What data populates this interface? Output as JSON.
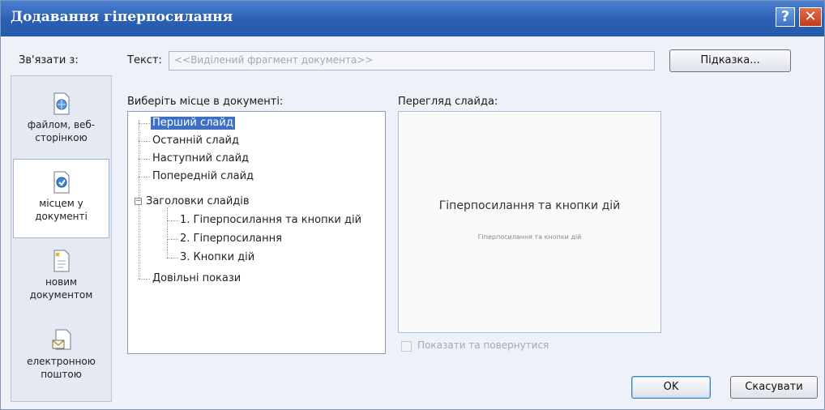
{
  "window": {
    "title": "Додавання гіперпосилання"
  },
  "title_buttons": {
    "help": "?",
    "close": "✕"
  },
  "link_to_label": "Зв'язати з:",
  "text_field": {
    "label": "Текст:",
    "value": "<<Виділений фрагмент документа>>"
  },
  "hint_button": "Підказка...",
  "side_items": [
    {
      "label1": "файлом, веб-",
      "label2": "сторінкою",
      "icon": "globe-file-icon"
    },
    {
      "label1": "місцем у",
      "label2": "документі",
      "icon": "document-place-icon"
    },
    {
      "label1": "новим",
      "label2": "документом",
      "icon": "new-document-icon"
    },
    {
      "label1": "електронною",
      "label2": "поштою",
      "icon": "email-icon"
    }
  ],
  "tree": {
    "label": "Виберіть місце в документі:",
    "items": [
      {
        "text": "Перший слайд"
      },
      {
        "text": "Останній слайд"
      },
      {
        "text": "Наступний слайд"
      },
      {
        "text": "Попередній слайд"
      },
      {
        "text": "Заголовки слайдів"
      },
      {
        "text": "1. Гіперпосилання та кнопки дій"
      },
      {
        "text": "2. Гіперпосилання"
      },
      {
        "text": "3. Кнопки дій"
      },
      {
        "text": "Довільні покази"
      }
    ],
    "selected_index": 0
  },
  "preview": {
    "label": "Перегляд слайда:",
    "slide_title": "Гіперпосилання та кнопки дій",
    "slide_subtitle": "Гіперпосилання та кнопки дій"
  },
  "show_and_return": {
    "label": "Показати та повернутися",
    "checked": false
  },
  "buttons": {
    "ok": "OK",
    "cancel": "Скасувати"
  }
}
